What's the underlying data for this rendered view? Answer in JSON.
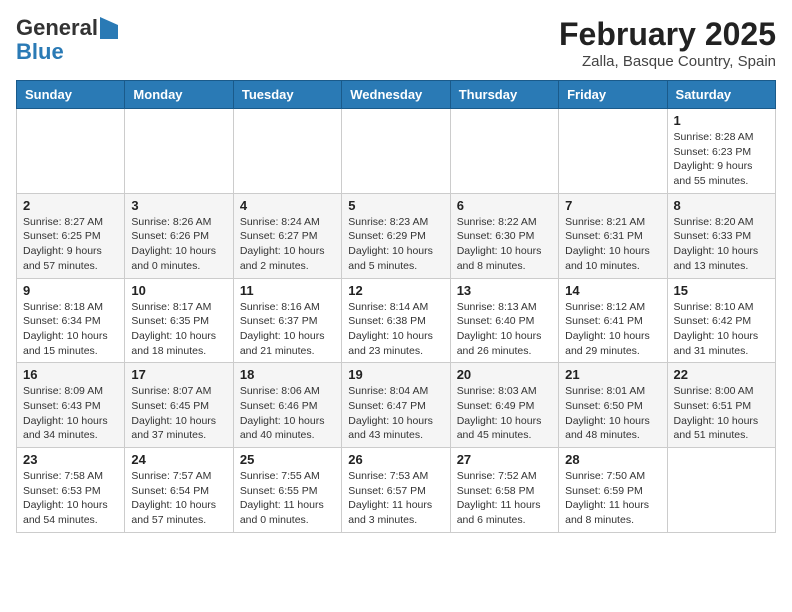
{
  "header": {
    "logo_general": "General",
    "logo_blue": "Blue",
    "month_title": "February 2025",
    "location": "Zalla, Basque Country, Spain"
  },
  "days_of_week": [
    "Sunday",
    "Monday",
    "Tuesday",
    "Wednesday",
    "Thursday",
    "Friday",
    "Saturday"
  ],
  "weeks": [
    [
      {
        "day": "",
        "info": ""
      },
      {
        "day": "",
        "info": ""
      },
      {
        "day": "",
        "info": ""
      },
      {
        "day": "",
        "info": ""
      },
      {
        "day": "",
        "info": ""
      },
      {
        "day": "",
        "info": ""
      },
      {
        "day": "1",
        "info": "Sunrise: 8:28 AM\nSunset: 6:23 PM\nDaylight: 9 hours and 55 minutes."
      }
    ],
    [
      {
        "day": "2",
        "info": "Sunrise: 8:27 AM\nSunset: 6:25 PM\nDaylight: 9 hours and 57 minutes."
      },
      {
        "day": "3",
        "info": "Sunrise: 8:26 AM\nSunset: 6:26 PM\nDaylight: 10 hours and 0 minutes."
      },
      {
        "day": "4",
        "info": "Sunrise: 8:24 AM\nSunset: 6:27 PM\nDaylight: 10 hours and 2 minutes."
      },
      {
        "day": "5",
        "info": "Sunrise: 8:23 AM\nSunset: 6:29 PM\nDaylight: 10 hours and 5 minutes."
      },
      {
        "day": "6",
        "info": "Sunrise: 8:22 AM\nSunset: 6:30 PM\nDaylight: 10 hours and 8 minutes."
      },
      {
        "day": "7",
        "info": "Sunrise: 8:21 AM\nSunset: 6:31 PM\nDaylight: 10 hours and 10 minutes."
      },
      {
        "day": "8",
        "info": "Sunrise: 8:20 AM\nSunset: 6:33 PM\nDaylight: 10 hours and 13 minutes."
      }
    ],
    [
      {
        "day": "9",
        "info": "Sunrise: 8:18 AM\nSunset: 6:34 PM\nDaylight: 10 hours and 15 minutes."
      },
      {
        "day": "10",
        "info": "Sunrise: 8:17 AM\nSunset: 6:35 PM\nDaylight: 10 hours and 18 minutes."
      },
      {
        "day": "11",
        "info": "Sunrise: 8:16 AM\nSunset: 6:37 PM\nDaylight: 10 hours and 21 minutes."
      },
      {
        "day": "12",
        "info": "Sunrise: 8:14 AM\nSunset: 6:38 PM\nDaylight: 10 hours and 23 minutes."
      },
      {
        "day": "13",
        "info": "Sunrise: 8:13 AM\nSunset: 6:40 PM\nDaylight: 10 hours and 26 minutes."
      },
      {
        "day": "14",
        "info": "Sunrise: 8:12 AM\nSunset: 6:41 PM\nDaylight: 10 hours and 29 minutes."
      },
      {
        "day": "15",
        "info": "Sunrise: 8:10 AM\nSunset: 6:42 PM\nDaylight: 10 hours and 31 minutes."
      }
    ],
    [
      {
        "day": "16",
        "info": "Sunrise: 8:09 AM\nSunset: 6:43 PM\nDaylight: 10 hours and 34 minutes."
      },
      {
        "day": "17",
        "info": "Sunrise: 8:07 AM\nSunset: 6:45 PM\nDaylight: 10 hours and 37 minutes."
      },
      {
        "day": "18",
        "info": "Sunrise: 8:06 AM\nSunset: 6:46 PM\nDaylight: 10 hours and 40 minutes."
      },
      {
        "day": "19",
        "info": "Sunrise: 8:04 AM\nSunset: 6:47 PM\nDaylight: 10 hours and 43 minutes."
      },
      {
        "day": "20",
        "info": "Sunrise: 8:03 AM\nSunset: 6:49 PM\nDaylight: 10 hours and 45 minutes."
      },
      {
        "day": "21",
        "info": "Sunrise: 8:01 AM\nSunset: 6:50 PM\nDaylight: 10 hours and 48 minutes."
      },
      {
        "day": "22",
        "info": "Sunrise: 8:00 AM\nSunset: 6:51 PM\nDaylight: 10 hours and 51 minutes."
      }
    ],
    [
      {
        "day": "23",
        "info": "Sunrise: 7:58 AM\nSunset: 6:53 PM\nDaylight: 10 hours and 54 minutes."
      },
      {
        "day": "24",
        "info": "Sunrise: 7:57 AM\nSunset: 6:54 PM\nDaylight: 10 hours and 57 minutes."
      },
      {
        "day": "25",
        "info": "Sunrise: 7:55 AM\nSunset: 6:55 PM\nDaylight: 11 hours and 0 minutes."
      },
      {
        "day": "26",
        "info": "Sunrise: 7:53 AM\nSunset: 6:57 PM\nDaylight: 11 hours and 3 minutes."
      },
      {
        "day": "27",
        "info": "Sunrise: 7:52 AM\nSunset: 6:58 PM\nDaylight: 11 hours and 6 minutes."
      },
      {
        "day": "28",
        "info": "Sunrise: 7:50 AM\nSunset: 6:59 PM\nDaylight: 11 hours and 8 minutes."
      },
      {
        "day": "",
        "info": ""
      }
    ]
  ]
}
